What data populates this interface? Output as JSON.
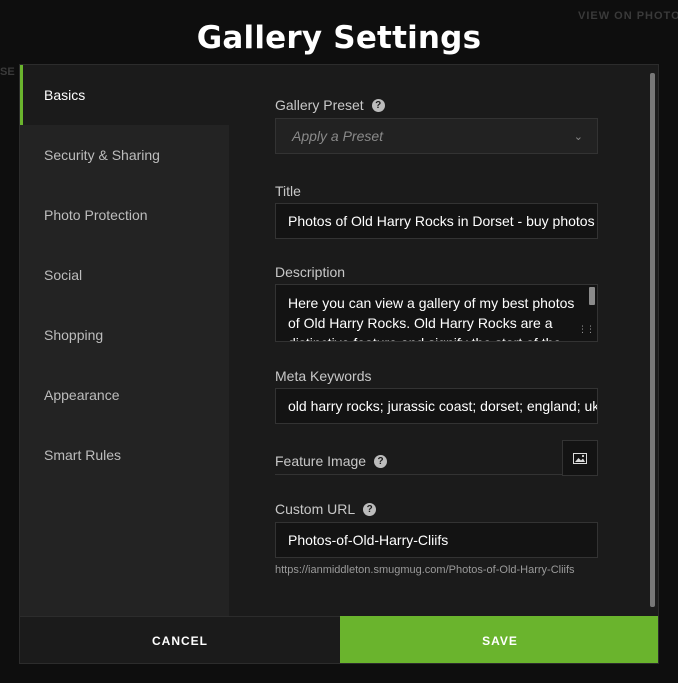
{
  "background": {
    "view_link": "VIEW ON PHOTO",
    "fragment": "SE"
  },
  "title": "Gallery Settings",
  "sidebar": {
    "items": [
      {
        "label": "Basics",
        "active": true
      },
      {
        "label": "Security & Sharing"
      },
      {
        "label": "Photo Protection"
      },
      {
        "label": "Social"
      },
      {
        "label": "Shopping"
      },
      {
        "label": "Appearance"
      },
      {
        "label": "Smart Rules"
      }
    ]
  },
  "form": {
    "preset": {
      "label": "Gallery Preset",
      "placeholder": "Apply a Preset",
      "icon": "chevron-down-icon"
    },
    "title": {
      "label": "Title",
      "value": "Photos of Old Harry Rocks in Dorset - buy photos"
    },
    "description": {
      "label": "Description",
      "value": "Here you can view a gallery of my best photos of Old Harry Rocks. Old Harry Rocks are a distinctive feature and signify the start of the"
    },
    "keywords": {
      "label": "Meta Keywords",
      "value": "old harry rocks; jurassic coast; dorset; england; uk"
    },
    "feature_image": {
      "label": "Feature Image",
      "icon": "image-icon"
    },
    "custom_url": {
      "label": "Custom URL",
      "value": "Photos-of-Old-Harry-Cliifs",
      "hint": "https://ianmiddleton.smugmug.com/Photos-of-Old-Harry-Cliifs"
    }
  },
  "footer": {
    "cancel_label": "CANCEL",
    "save_label": "SAVE"
  },
  "colors": {
    "accent": "#6ab42d",
    "background": "#1b1b1b",
    "sidebar": "#232323"
  }
}
